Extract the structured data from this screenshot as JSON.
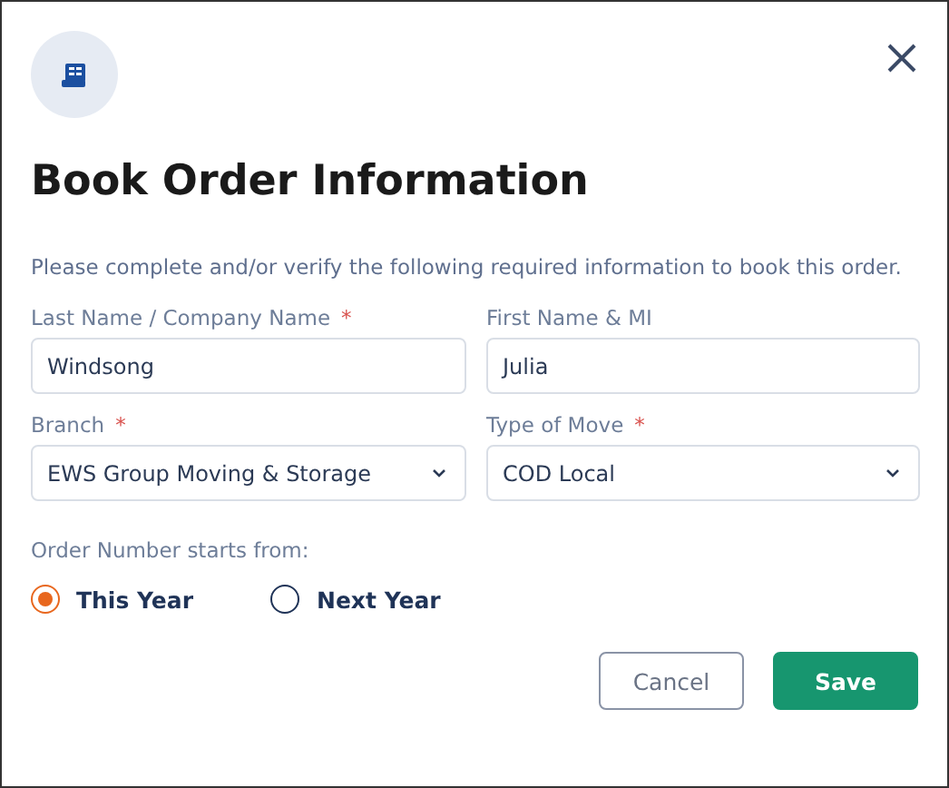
{
  "dialog": {
    "title": "Book Order Information",
    "instructions": "Please complete and/or verify the following required information to book this order.",
    "fields": [
      {
        "label": "Last Name / Company Name",
        "required_mark": "*",
        "kind": "text",
        "value": "Windsong"
      },
      {
        "label": "First Name & MI",
        "kind": "text",
        "value": "Julia"
      },
      {
        "label": "Branch",
        "required_mark": "*",
        "kind": "select",
        "value": "EWS Group Moving & Storage"
      },
      {
        "label": "Type of Move",
        "required_mark": "*",
        "kind": "select",
        "value": "COD Local"
      }
    ],
    "order_number": {
      "label": "Order Number starts from:",
      "options": [
        {
          "label": "This Year",
          "selected": true
        },
        {
          "label": "Next Year",
          "selected": false
        }
      ]
    },
    "buttons": [
      {
        "label": "Cancel",
        "kind": "secondary"
      },
      {
        "label": "Save",
        "kind": "primary"
      }
    ]
  }
}
